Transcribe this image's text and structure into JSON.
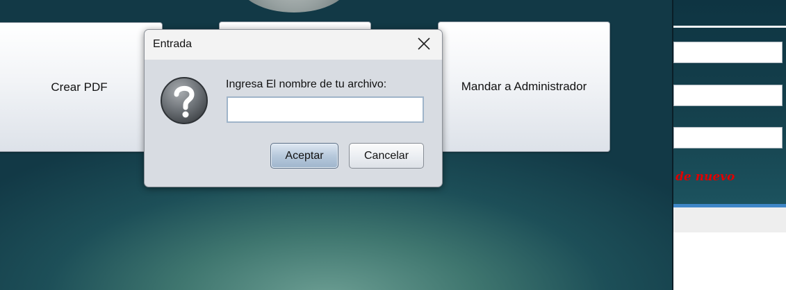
{
  "background": {
    "buttons": {
      "crear_pdf": "Crear PDF",
      "mandar_admin": "Mandar a Administrador"
    },
    "right_panel": {
      "error_text": "de nuevo"
    }
  },
  "dialog": {
    "title": "Entrada",
    "close_icon": "close-icon",
    "icon": "question-icon",
    "prompt": "Ingresa El nombre de tu archivo:",
    "input": {
      "value": "",
      "placeholder": ""
    },
    "accept_label": "Aceptar",
    "cancel_label": "Cancelar"
  },
  "colors": {
    "error_text": "#e00000",
    "accent_blue": "#3f86c7"
  }
}
